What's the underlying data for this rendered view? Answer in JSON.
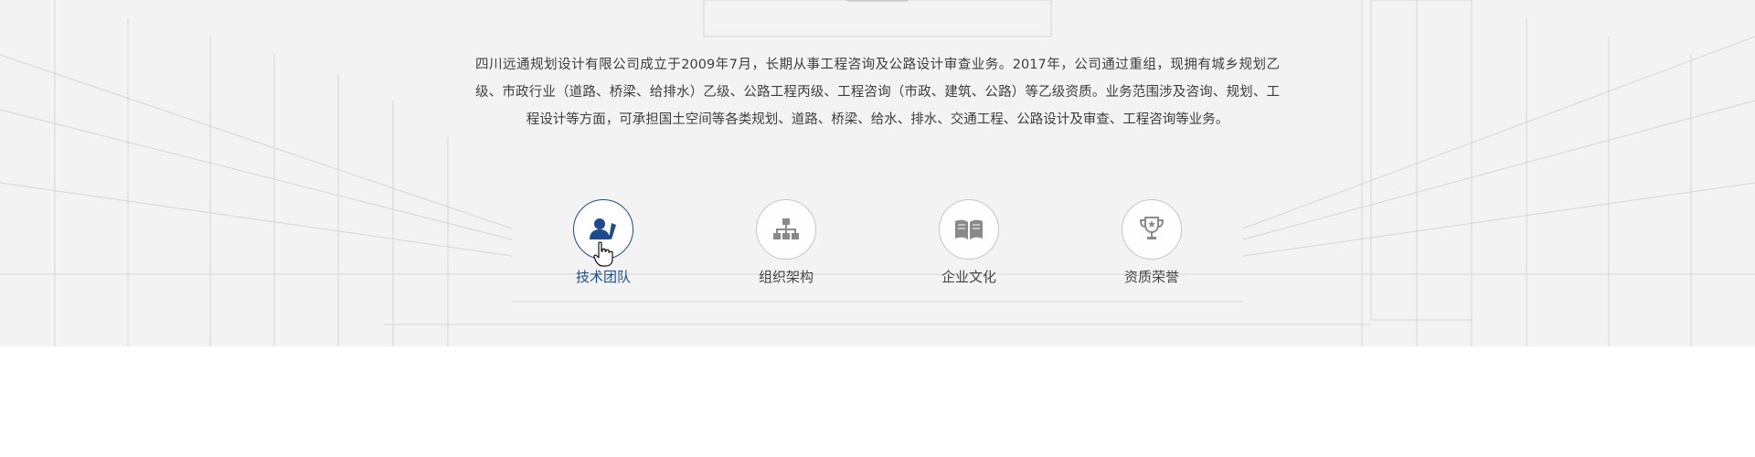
{
  "about": {
    "intro_text": "四川远通规划设计有限公司成立于2009年7月，长期从事工程咨询及公路设计审查业务。2017年，公司通过重组，现拥有城乡规划乙级、市政行业（道路、桥梁、给排水）乙级、公路工程丙级、工程咨询（市政、建筑、公路）等乙级资质。业务范围涉及咨询、规划、工程设计等方面，可承担国土空间等各类规划、道路、桥梁、给水、排水、交通工程、公路设计及审查、工程咨询等业务。"
  },
  "nav": {
    "items": [
      {
        "label": "技术团队",
        "icon": "team-icon",
        "active": true
      },
      {
        "label": "组织架构",
        "icon": "org-chart-icon",
        "active": false
      },
      {
        "label": "企业文化",
        "icon": "book-icon",
        "active": false
      },
      {
        "label": "资质荣誉",
        "icon": "trophy-icon",
        "active": false
      }
    ]
  },
  "colors": {
    "accent": "#1c4c8f",
    "icon_gray": "#8a8a8a",
    "text": "#3d3d3d",
    "section_bg": "#f3f3f3"
  }
}
